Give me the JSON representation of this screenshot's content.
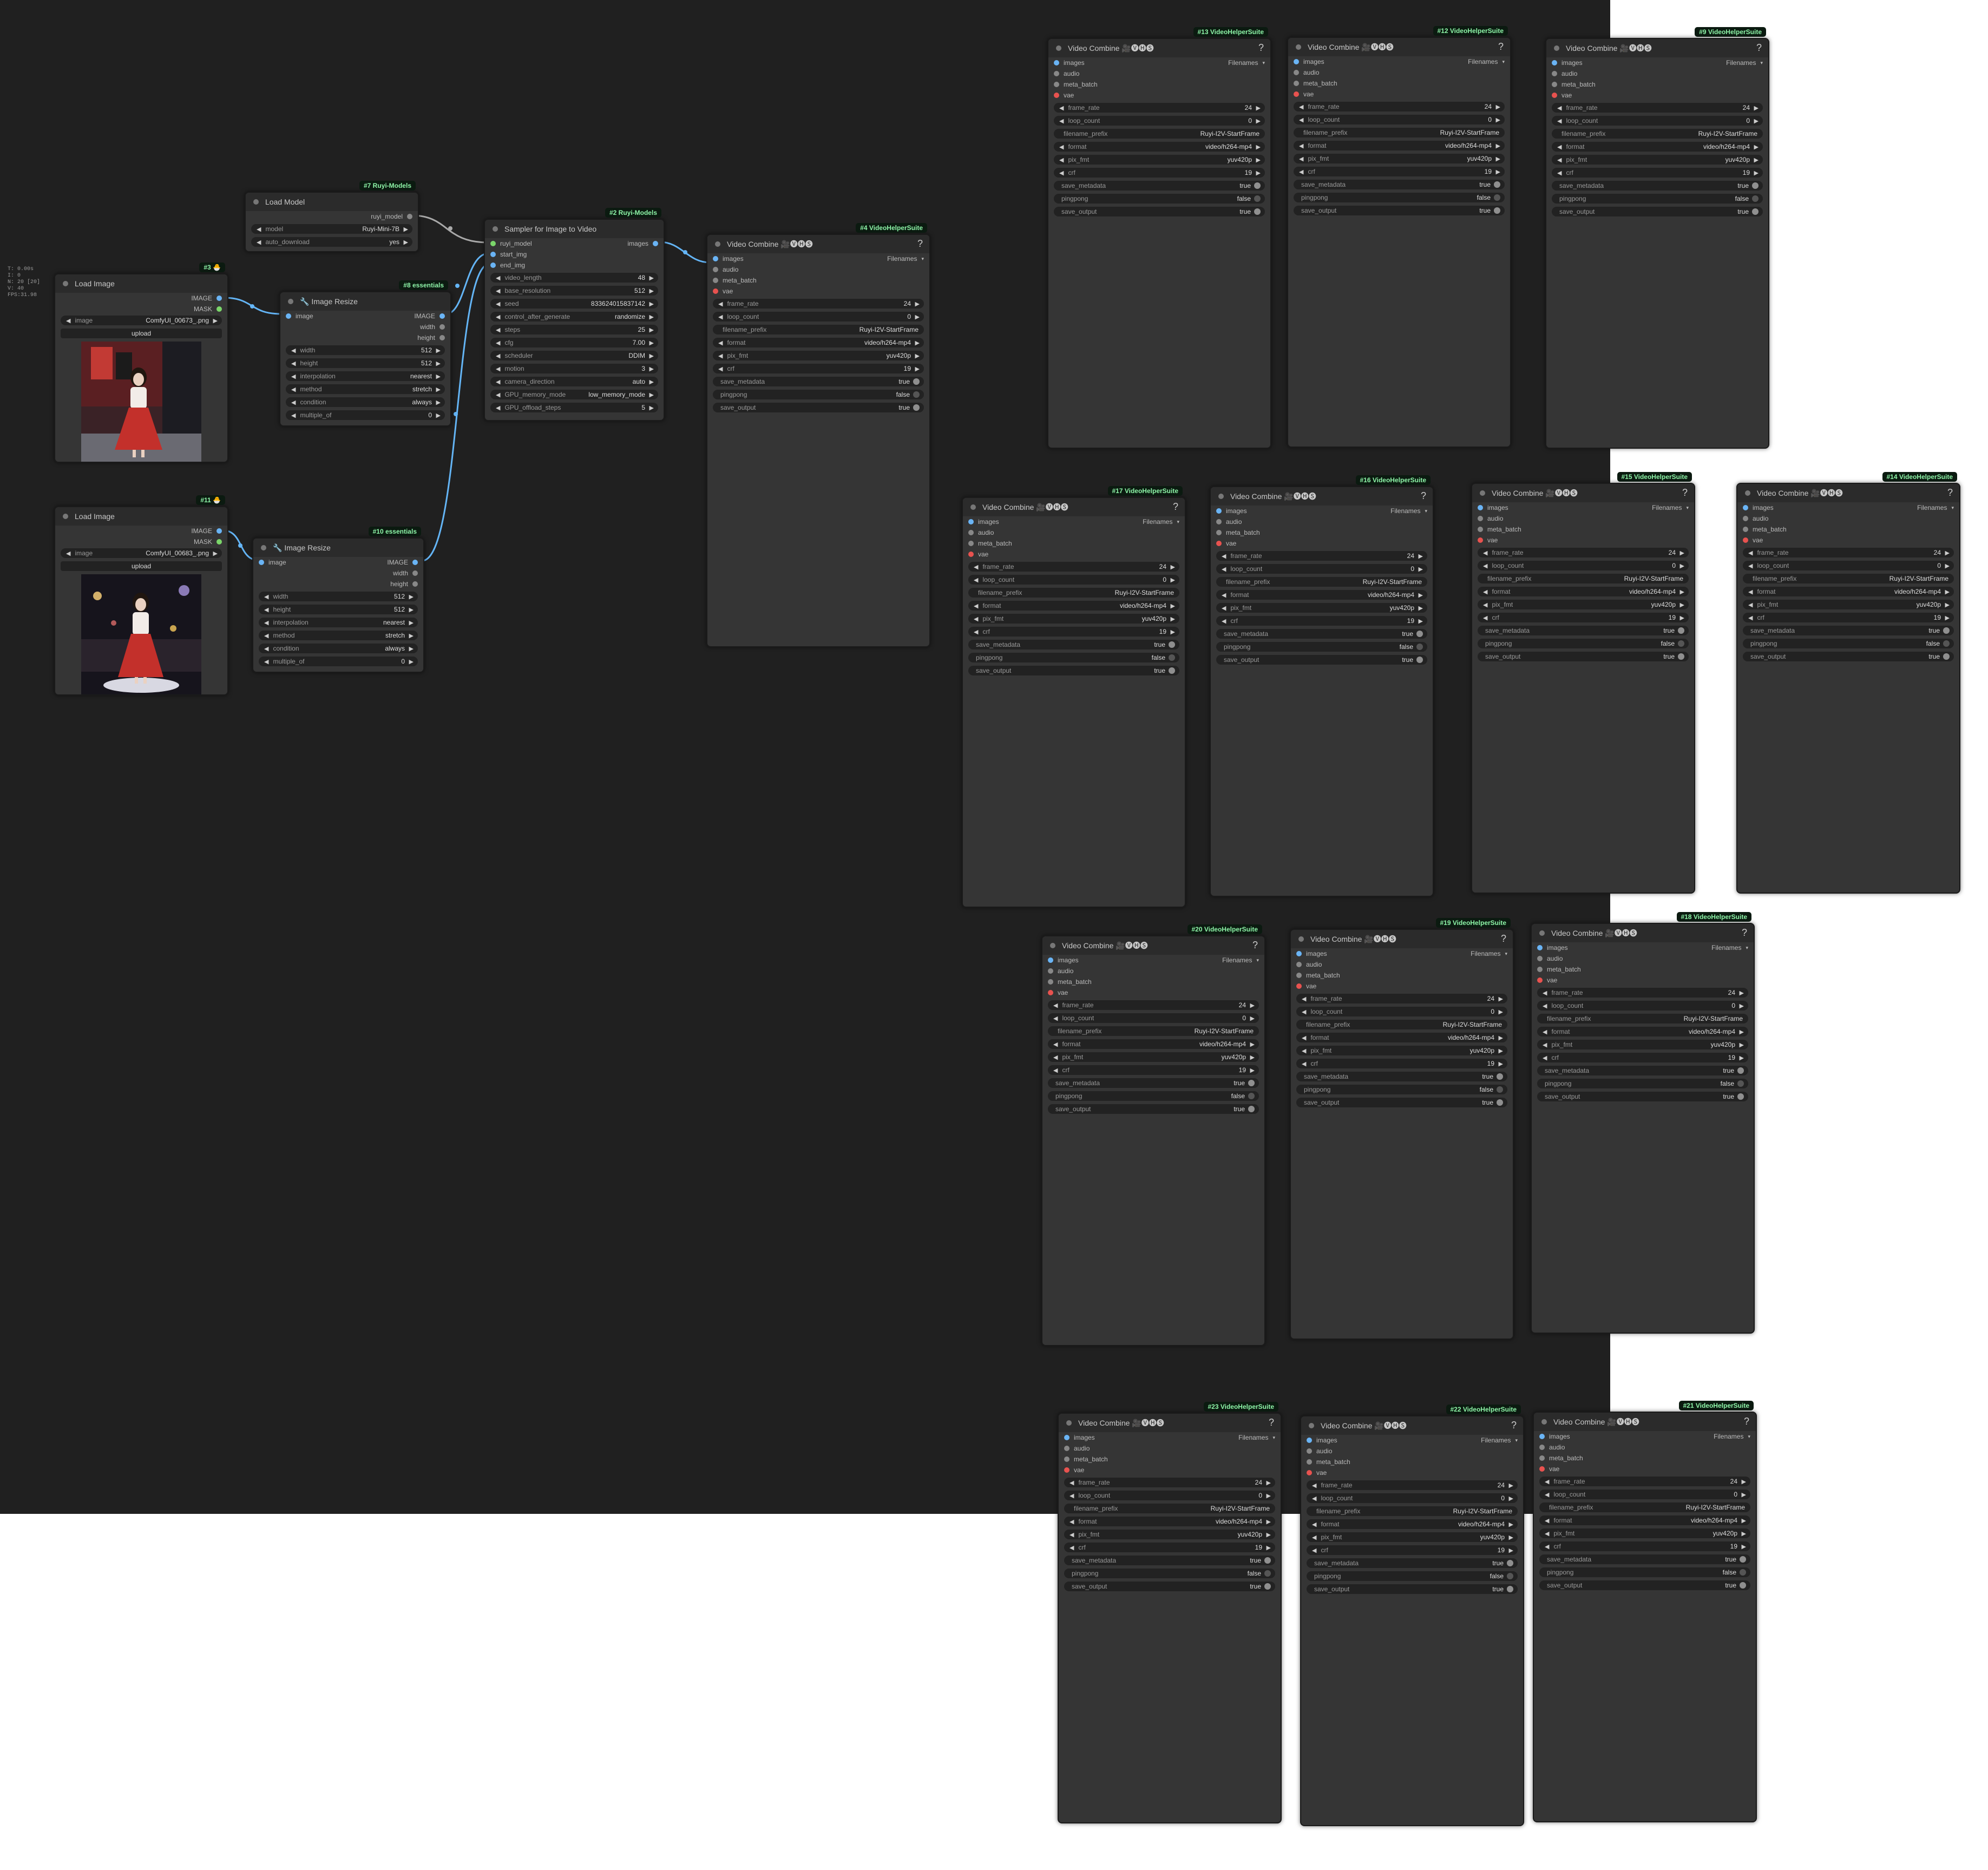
{
  "stats": [
    "T: 0.00s",
    "I: 0",
    "N: 20 [20]",
    "V: 40",
    "FPS:31.98"
  ],
  "load_model": {
    "badge": "#7 Ruyi-Models",
    "title": "Load Model",
    "out": "ruyi_model",
    "model_label": "model",
    "model_value": "Ruyi-Mini-7B",
    "auto_label": "auto_download",
    "auto_value": "yes"
  },
  "load_image_3": {
    "badge": "#3 🐣",
    "title": "Load Image",
    "out_image": "IMAGE",
    "out_mask": "MASK",
    "image_label": "image",
    "image_value": "ComfyUI_00673_.png",
    "upload": "upload"
  },
  "load_image_11": {
    "badge": "#11 🐣",
    "title": "Load Image",
    "out_image": "IMAGE",
    "out_mask": "MASK",
    "image_label": "image",
    "image_value": "ComfyUI_00683_.png",
    "upload": "upload"
  },
  "resize_8": {
    "badge": "#8 essentials",
    "title": "🔧 Image Resize",
    "in": "image",
    "out_image": "IMAGE",
    "out_width": "width",
    "out_height": "height",
    "widgets": [
      [
        "width",
        "512"
      ],
      [
        "height",
        "512"
      ],
      [
        "interpolation",
        "nearest"
      ],
      [
        "method",
        "stretch"
      ],
      [
        "condition",
        "always"
      ],
      [
        "multiple_of",
        "0"
      ]
    ]
  },
  "resize_10": {
    "badge": "#10 essentials",
    "title": "🔧 Image Resize",
    "in": "image",
    "out_image": "IMAGE",
    "out_width": "width",
    "out_height": "height",
    "widgets": [
      [
        "width",
        "512"
      ],
      [
        "height",
        "512"
      ],
      [
        "interpolation",
        "nearest"
      ],
      [
        "method",
        "stretch"
      ],
      [
        "condition",
        "always"
      ],
      [
        "multiple_of",
        "0"
      ]
    ]
  },
  "sampler": {
    "badge": "#2 Ruyi-Models",
    "title": "Sampler for Image to Video",
    "in": [
      "ruyi_model",
      "start_img",
      "end_img"
    ],
    "out": "images",
    "widgets": [
      [
        "video_length",
        "48"
      ],
      [
        "base_resolution",
        "512"
      ],
      [
        "seed",
        "833624015837142"
      ],
      [
        "control_after_generate",
        "randomize"
      ],
      [
        "steps",
        "25"
      ],
      [
        "cfg",
        "7.00"
      ],
      [
        "scheduler",
        "DDIM"
      ],
      [
        "motion",
        "3"
      ],
      [
        "camera_direction",
        "auto"
      ],
      [
        "GPU_memory_mode",
        "low_memory_mode"
      ],
      [
        "GPU_offload_steps",
        "5"
      ]
    ]
  },
  "video_combine": {
    "title": "Video Combine 🎥🅥🅗🅢",
    "inputs": [
      "images",
      "audio",
      "meta_batch",
      "vae"
    ],
    "out": "Filenames",
    "widgets": [
      [
        "frame_rate",
        "24"
      ],
      [
        "loop_count",
        "0"
      ],
      [
        "filename_prefix",
        "Ruyi-I2V-StartFrame"
      ],
      [
        "format",
        "video/h264-mp4"
      ],
      [
        "pix_fmt",
        "yuv420p"
      ],
      [
        "crf",
        "19"
      ]
    ],
    "toggles": [
      [
        "save_metadata",
        "true"
      ],
      [
        "pingpong",
        "false"
      ],
      [
        "save_output",
        "true"
      ]
    ]
  },
  "vc_badges": [
    "#4 VideoHelperSuite",
    "#13 VideoHelperSuite",
    "#12 VideoHelperSuite",
    "#9 VideoHelperSuite",
    "#17 VideoHelperSuite",
    "#16 VideoHelperSuite",
    "#15 VideoHelperSuite",
    "#14 VideoHelperSuite",
    "#20 VideoHelperSuite",
    "#19 VideoHelperSuite",
    "#18 VideoHelperSuite",
    "#23 VideoHelperSuite",
    "#22 VideoHelperSuite",
    "#21 VideoHelperSuite"
  ],
  "colors": {
    "canvas": "#202020",
    "node": "#353535",
    "header": "#2b2b2b",
    "widget": "#222222",
    "wire_image": "#64b5f6",
    "wire_model": "#a9a9a9",
    "badge_text": "#8ef5a8"
  }
}
